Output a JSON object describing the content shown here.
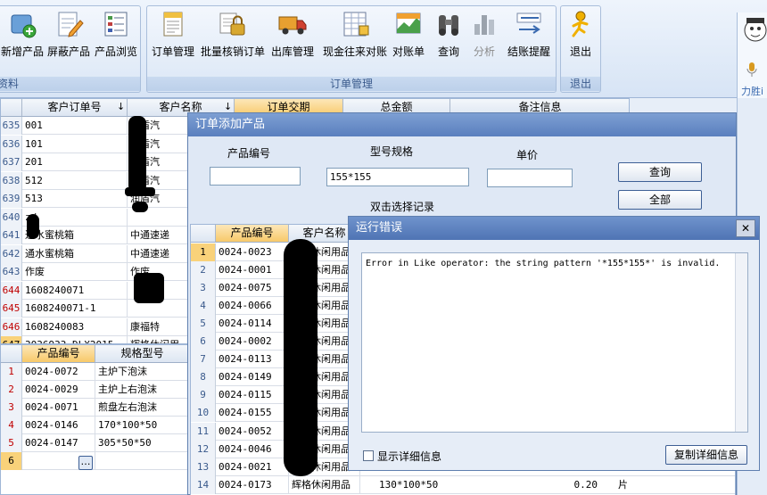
{
  "ribbon": {
    "group1_buttons": [
      "新增产品",
      "屏蔽产品",
      "产品浏览"
    ],
    "group1_label": "资料",
    "group2_buttons": [
      "订单管理",
      "批量核销订单",
      "出库管理",
      "现金往来对账",
      "对账单",
      "查询",
      "分析",
      "结账提醒"
    ],
    "group2_label": "订单管理",
    "group3_buttons": [
      "退出"
    ],
    "group3_label": "退出",
    "side_text": "力胜i"
  },
  "top_grid": {
    "columns": [
      "客户订单号",
      "客户名称",
      "订单交期",
      "总金额",
      "备注信息"
    ],
    "sort_marks": [
      "↓",
      "↓"
    ],
    "rows": [
      {
        "num": "635",
        "order": "001",
        "cust": "润盾汽"
      },
      {
        "num": "636",
        "order": "101",
        "cust": "润盾汽"
      },
      {
        "num": "637",
        "order": "201",
        "cust": "润盾汽"
      },
      {
        "num": "638",
        "order": "512",
        "cust": "润盾汽"
      },
      {
        "num": "639",
        "order": "513",
        "cust": "润盾汽"
      },
      {
        "num": "640",
        "order": "zd",
        "cust": ""
      },
      {
        "num": "641",
        "order": "通水蜜桃箱",
        "cust": "中通速递"
      },
      {
        "num": "642",
        "order": "通水蜜桃箱",
        "cust": "中通速递"
      },
      {
        "num": "643",
        "order": "作废",
        "cust": "作废"
      },
      {
        "num": "644",
        "order": "1608240071",
        "cust": ""
      },
      {
        "num": "645",
        "order": "1608240071-1",
        "cust": ""
      },
      {
        "num": "646",
        "order": "1608240083",
        "cust": "康福特"
      },
      {
        "num": "647",
        "order": "3036933 DLX2015",
        "cust": "辉格休闲用"
      }
    ]
  },
  "bottom_grid": {
    "columns": [
      "产品编号",
      "规格型号"
    ],
    "rows": [
      {
        "num": "1",
        "code": "0024-0072",
        "spec": "主炉下泡沫"
      },
      {
        "num": "2",
        "code": "0024-0029",
        "spec": "主炉上右泡沫"
      },
      {
        "num": "3",
        "code": "0024-0071",
        "spec": "煎盘左右泡沫"
      },
      {
        "num": "4",
        "code": "0024-0146",
        "spec": "170*100*50"
      },
      {
        "num": "5",
        "code": "0024-0147",
        "spec": "305*50*50"
      },
      {
        "num": "6",
        "code": "",
        "spec": ""
      }
    ],
    "ellipsis": "…"
  },
  "add_dialog": {
    "title": "订单添加产品",
    "label_code": "产品编号",
    "label_spec": "型号规格",
    "label_price": "单价",
    "value_code": "",
    "value_spec": "155*155",
    "value_price": "",
    "btn_query": "查询",
    "btn_all": "全部",
    "hint": "双击选择记录",
    "columns": [
      "产品编号",
      "客户名称"
    ],
    "rows": [
      {
        "num": "1",
        "code": "0024-0023",
        "name": "辉格休闲用品"
      },
      {
        "num": "2",
        "code": "0024-0001",
        "name": "辉格休闲用品"
      },
      {
        "num": "3",
        "code": "0024-0075",
        "name": "辉格休闲用品"
      },
      {
        "num": "4",
        "code": "0024-0066",
        "name": "辉格休闲用品"
      },
      {
        "num": "5",
        "code": "0024-0114",
        "name": "辉格休闲用品"
      },
      {
        "num": "6",
        "code": "0024-0002",
        "name": "辉格休闲用品"
      },
      {
        "num": "7",
        "code": "0024-0113",
        "name": "辉格休闲用品"
      },
      {
        "num": "8",
        "code": "0024-0149",
        "name": "辉格休闲用品"
      },
      {
        "num": "9",
        "code": "0024-0115",
        "name": "辉格休闲用品"
      },
      {
        "num": "10",
        "code": "0024-0155",
        "name": "辉格休闲用品"
      },
      {
        "num": "11",
        "code": "0024-0052",
        "name": "辉格休闲用品"
      },
      {
        "num": "12",
        "code": "0024-0046",
        "name": "辉格休闲用品"
      },
      {
        "num": "13",
        "code": "0024-0021",
        "name": "辉格休闲用品"
      },
      {
        "num": "14",
        "code": "0024-0173",
        "name": "辉格休闲用品",
        "spec": "130*100*50",
        "price": "0.20",
        "unit": "片"
      }
    ]
  },
  "error_dialog": {
    "title": "运行错误",
    "message": "Error in Like operator: the string pattern '*155*155*' is invalid.",
    "checkbox_label": "显示详细信息",
    "btn_copy": "复制详细信息",
    "close": "✕"
  },
  "colors": {
    "accent": "#5a7fbe",
    "title_bar": "#7d9fd3",
    "selected_header": "#f7c96a",
    "red_rownum": "#c00000"
  }
}
